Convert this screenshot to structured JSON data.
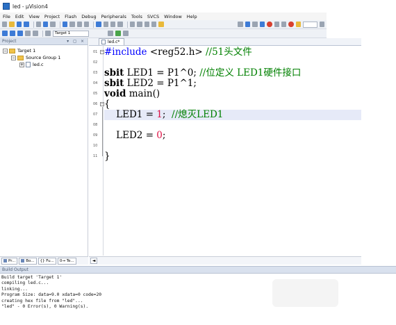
{
  "window": {
    "title": "led - µVision4"
  },
  "menu": [
    "File",
    "Edit",
    "View",
    "Project",
    "Flash",
    "Debug",
    "Peripherals",
    "Tools",
    "SVCS",
    "Window",
    "Help"
  ],
  "toolbar2": {
    "target": "Target 1"
  },
  "project_panel": {
    "header": "Project",
    "controls": "▾ ◻ ×",
    "tree": {
      "root": "Target 1",
      "group": "Source Group 1",
      "file": "led.c"
    },
    "tabs": [
      "Pr...",
      "Bo...",
      "{} Fu...",
      "0→ Te..."
    ]
  },
  "editor": {
    "tab": "led.c*",
    "lines": [
      {
        "no": "01",
        "parts": [
          {
            "t": "#include",
            "c": "pp"
          },
          {
            "t": " <reg52.h> ",
            "c": ""
          },
          {
            "t": "//51头文件",
            "c": "cm"
          }
        ]
      },
      {
        "no": "02",
        "parts": []
      },
      {
        "no": "03",
        "parts": [
          {
            "t": "sbit",
            "c": "bold"
          },
          {
            "t": " LED1 = P1^0; ",
            "c": ""
          },
          {
            "t": "//位定义 LED1硬件接口",
            "c": "cm"
          }
        ]
      },
      {
        "no": "04",
        "parts": [
          {
            "t": "sbit",
            "c": "bold"
          },
          {
            "t": " LED2 = P1^1;",
            "c": ""
          }
        ]
      },
      {
        "no": "05",
        "parts": [
          {
            "t": "void",
            "c": "bold"
          },
          {
            "t": " main()",
            "c": ""
          }
        ]
      },
      {
        "no": "06",
        "parts": [
          {
            "t": "{",
            "c": ""
          }
        ]
      },
      {
        "no": "07",
        "parts": [
          {
            "t": "    LED1 = ",
            "c": ""
          },
          {
            "t": "1",
            "c": "num"
          },
          {
            "t": ";  ",
            "c": ""
          },
          {
            "t": "//熄灭LED1",
            "c": "cm"
          }
        ]
      },
      {
        "no": "08",
        "parts": []
      },
      {
        "no": "09",
        "parts": [
          {
            "t": "    LED2 = ",
            "c": ""
          },
          {
            "t": "0",
            "c": "num"
          },
          {
            "t": ";",
            "c": ""
          }
        ]
      },
      {
        "no": "10",
        "parts": []
      },
      {
        "no": "11",
        "parts": [
          {
            "t": "}",
            "c": ""
          }
        ]
      }
    ],
    "highlighted_line": "07",
    "scroll_left": "◄"
  },
  "build_output": {
    "header": "Build Output",
    "text": "Build target 'Target 1'\ncompiling led.c...\nlinking...\nProgram Size: data=9.0 xdata=0 code=20\ncreating hex file from \"led\"...\n\"led\" - 0 Error(s), 0 Warning(s)."
  }
}
